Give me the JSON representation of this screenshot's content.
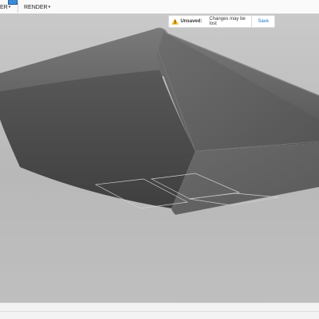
{
  "toolbar": {
    "prev_menu_label": "ER",
    "render_label": "RENDER",
    "caret": "▾"
  },
  "notification": {
    "status": "Unsaved:",
    "message": "Changes may be lost",
    "save_label": "Save"
  },
  "colors": {
    "accent": "#1a73c7",
    "warning": "#f2b01e",
    "viewport_bg": "#c2c2c2",
    "model_dark": "#4a4a4a",
    "model_light": "#6b6b6b"
  },
  "navbar": {
    "tools": [
      "orbit-icon",
      "look-at-icon",
      "pan-icon",
      "zoom-icon",
      "fit-icon",
      "display-settings-icon",
      "grid-settings-icon"
    ]
  }
}
